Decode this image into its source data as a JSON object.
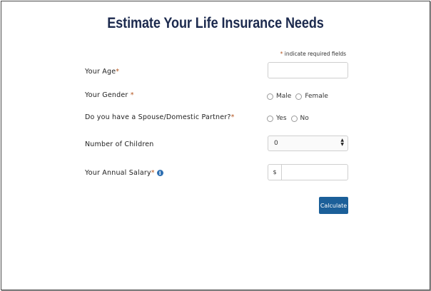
{
  "page": {
    "title": "Estimate Your Life Insurance Needs",
    "required_note_star": "*",
    "required_note_text": " indicate required fields"
  },
  "form": {
    "age": {
      "label": "Your Age",
      "star": "*",
      "value": ""
    },
    "gender": {
      "label": "Your Gender ",
      "star": "*",
      "options": [
        "Male",
        "Female"
      ],
      "selected": null
    },
    "spouse": {
      "label": "Do you have a Spouse/Domestic Partner?",
      "star": "*",
      "options": [
        "Yes",
        "No"
      ],
      "selected": null
    },
    "children": {
      "label": "Number of Children",
      "value": "0",
      "icon": "updown-arrows-icon"
    },
    "salary": {
      "label": "Your Annual Salary",
      "star": "*",
      "info_icon": "info-icon",
      "info_glyph": "i",
      "prefix": "$",
      "value": ""
    },
    "calculate_label": "Calculate"
  },
  "colors": {
    "title": "#1c2a4e",
    "required_star": "#b3541e",
    "button": "#1b5f99",
    "info_icon": "#2e6fb2"
  }
}
